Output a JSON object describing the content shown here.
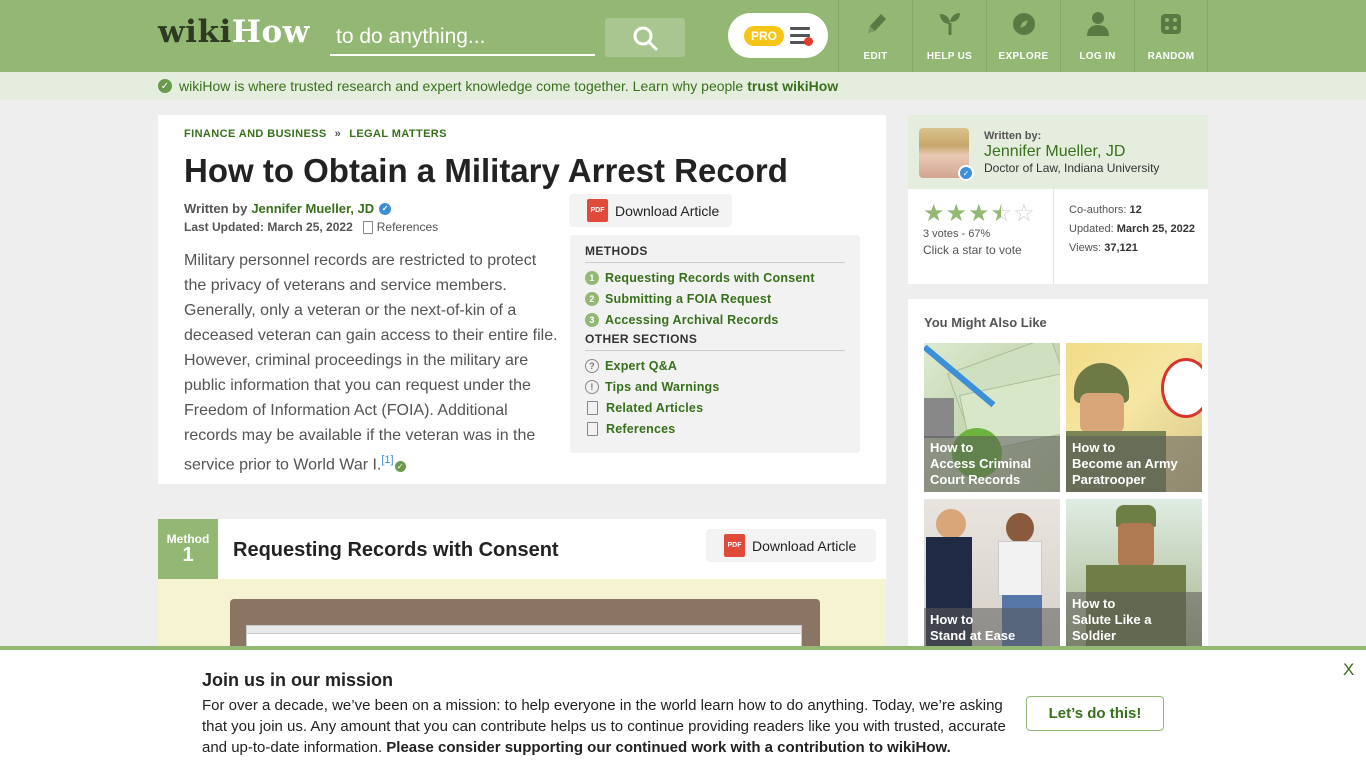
{
  "header": {
    "logo_wiki": "wiki",
    "logo_how": "How",
    "search_placeholder": "to do anything...",
    "pro_label": "PRO",
    "nav": [
      {
        "label": "EDIT",
        "icon": "pencil-icon"
      },
      {
        "label": "HELP US",
        "icon": "sprout-icon"
      },
      {
        "label": "EXPLORE",
        "icon": "compass-icon"
      },
      {
        "label": "LOG IN",
        "icon": "user-icon"
      },
      {
        "label": "RANDOM",
        "icon": "dice-icon"
      }
    ]
  },
  "trustbar": {
    "text": "wikiHow is where trusted research and expert knowledge come together. Learn why people",
    "link": "trust wikiHow"
  },
  "article": {
    "breadcrumbs": [
      "FINANCE AND BUSINESS",
      "LEGAL MATTERS"
    ],
    "breadcrumb_sep": "»",
    "title": "How to Obtain a Military Arrest Record",
    "written_by_label": "Written by",
    "author": "Jennifer Mueller, JD",
    "updated_label": "Last Updated:",
    "updated_date": "March 25, 2022",
    "references_label": "References",
    "intro": "Military personnel records are restricted to protect the privacy of veterans and service members. Generally, only a veteran or the next-of-kin of a deceased veteran can gain access to their entire file. However, criminal proceedings in the military are public information that you can request under the Freedom of Information Act (FOIA). Additional records may be available if the veteran was in the service prior to World War I.",
    "citation": "[1]",
    "download_label": "Download Article",
    "pdf_label": "PDF"
  },
  "toc": {
    "methods_heading": "METHODS",
    "methods": [
      {
        "num": "1",
        "label": "Requesting Records with Consent"
      },
      {
        "num": "2",
        "label": "Submitting a FOIA Request"
      },
      {
        "num": "3",
        "label": "Accessing Archival Records"
      }
    ],
    "other_heading": "OTHER SECTIONS",
    "other": [
      {
        "label": "Expert Q&A",
        "icon": "question-icon"
      },
      {
        "label": "Tips and Warnings",
        "icon": "exclamation-icon"
      },
      {
        "label": "Related Articles",
        "icon": "article-icon"
      },
      {
        "label": "References",
        "icon": "bookmark-icon"
      }
    ]
  },
  "method": {
    "word": "Method",
    "number": "1",
    "title": "Requesting Records with Consent",
    "download_label": "Download Article"
  },
  "author_card": {
    "written_by": "Written by:",
    "name": "Jennifer Mueller, JD",
    "credential": "Doctor of Law, Indiana University",
    "rating": 3.5,
    "votes_text": "3 votes - 67%",
    "click_text": "Click a star to vote",
    "coauthors_label": "Co-authors:",
    "coauthors": "12",
    "updated_label": "Updated:",
    "updated": "March 25, 2022",
    "views_label": "Views:",
    "views": "37,121"
  },
  "related": {
    "heading": "You Might Also Like",
    "items": [
      {
        "prefix": "How to",
        "title": "Access Criminal Court Records"
      },
      {
        "prefix": "How to",
        "title": "Become an Army Paratrooper"
      },
      {
        "prefix": "How to",
        "title": "Stand at Ease"
      },
      {
        "prefix": "How to",
        "title": "Salute Like a Soldier"
      }
    ]
  },
  "banner": {
    "title": "Join us in our mission",
    "text": "For over a decade, we’ve been on a mission: to help everyone in the world learn how to do anything. Today, we’re asking that you join us. Any amount that you can contribute helps us to continue providing readers like you with trusted, accurate and up-to-date information.",
    "bold_text": "Please consider supporting our continued work with a contribution to wikiHow.",
    "cta": "Let’s do this!",
    "close": "X"
  },
  "colors": {
    "brand_green": "#93b874",
    "link_green": "#38701b",
    "pdf_red": "#e04a3b",
    "verified_blue": "#3d8fd8"
  }
}
